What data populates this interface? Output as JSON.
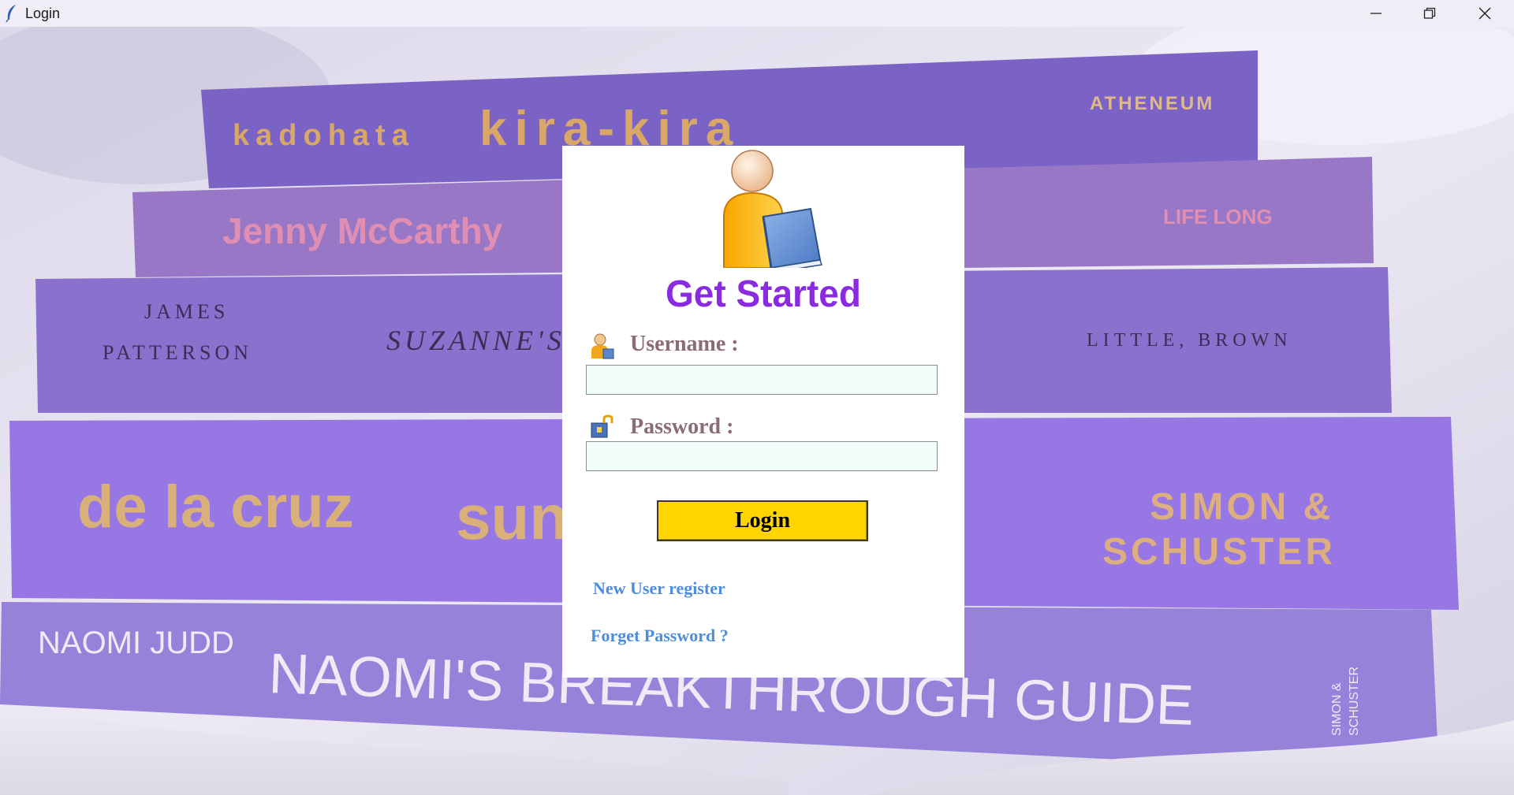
{
  "window": {
    "title": "Login",
    "controls": [
      "minimize-icon",
      "restore-icon",
      "close-icon"
    ]
  },
  "background": {
    "book_spines": [
      {
        "author": "kadohata",
        "title": "kira-kira",
        "publisher": "ATHENEUM",
        "color": "#7b64c6"
      },
      {
        "author": "Jenny McCarthy",
        "publisher": "LIFE LONG",
        "color": "#9a78c8"
      },
      {
        "author_line1": "JAMES",
        "author_line2": "PATTERSON",
        "title": "SUZANNE'S",
        "publisher": "LITTLE, BROWN",
        "color": "#8e72cf"
      },
      {
        "author": "de la cruz",
        "title": "sun",
        "publisher_line1": "SIMON &",
        "publisher_line2": "SCHUSTER",
        "color": "#9a7ae6"
      },
      {
        "author": "NAOMI JUDD",
        "title": "NAOMI'S BREAKTHROUGH GUIDE",
        "publisher_line1": "SIMON &",
        "publisher_line2": "SCHUSTER",
        "color": "#9a84dc"
      }
    ]
  },
  "card": {
    "logo_icon": "user-book-icon",
    "heading": "Get Started",
    "username": {
      "label": "Username :",
      "icon": "user-icon",
      "value": "",
      "placeholder": ""
    },
    "password": {
      "label": "Password :",
      "icon": "lock-icon",
      "value": "",
      "placeholder": ""
    },
    "login_label": "Login",
    "register_link": "New User register",
    "forgot_link": "Forget Password ?"
  },
  "colors": {
    "heading": "#8a2be2",
    "label": "#8b6b77",
    "input_bg": "#f2fff9",
    "button_bg": "#ffd500",
    "link": "#4e8ddb"
  }
}
